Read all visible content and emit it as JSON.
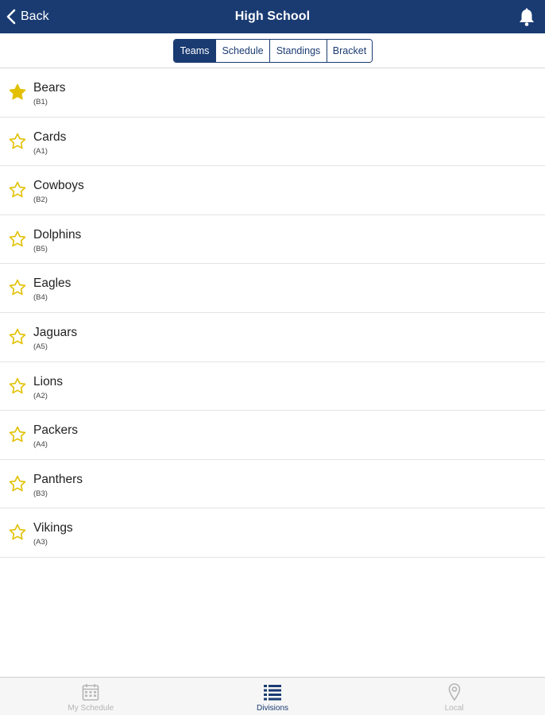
{
  "header": {
    "back_label": "Back",
    "title": "High School",
    "bell_icon": "bell-icon",
    "bg_color": "#1a3b72"
  },
  "segments": {
    "items": [
      "Teams",
      "Schedule",
      "Standings",
      "Bracket"
    ],
    "selected": "Teams"
  },
  "teams": [
    {
      "name": "Bears",
      "code": "(B1)",
      "favorite": true
    },
    {
      "name": "Cards",
      "code": "(A1)",
      "favorite": false
    },
    {
      "name": "Cowboys",
      "code": "(B2)",
      "favorite": false
    },
    {
      "name": "Dolphins",
      "code": "(B5)",
      "favorite": false
    },
    {
      "name": "Eagles",
      "code": "(B4)",
      "favorite": false
    },
    {
      "name": "Jaguars",
      "code": "(A5)",
      "favorite": false
    },
    {
      "name": "Lions",
      "code": "(A2)",
      "favorite": false
    },
    {
      "name": "Packers",
      "code": "(A4)",
      "favorite": false
    },
    {
      "name": "Panthers",
      "code": "(B3)",
      "favorite": false
    },
    {
      "name": "Vikings",
      "code": "(A3)",
      "favorite": false
    }
  ],
  "star_color": "#e2c000",
  "tabbar": {
    "tabs": [
      {
        "label": "My Schedule",
        "icon": "calendar-icon",
        "active": false
      },
      {
        "label": "Divisions",
        "icon": "list-icon",
        "active": true
      },
      {
        "label": "Local",
        "icon": "location-pin-icon",
        "active": false
      }
    ],
    "active_color": "#1a3b72",
    "inactive_color": "#b5b5b5"
  }
}
